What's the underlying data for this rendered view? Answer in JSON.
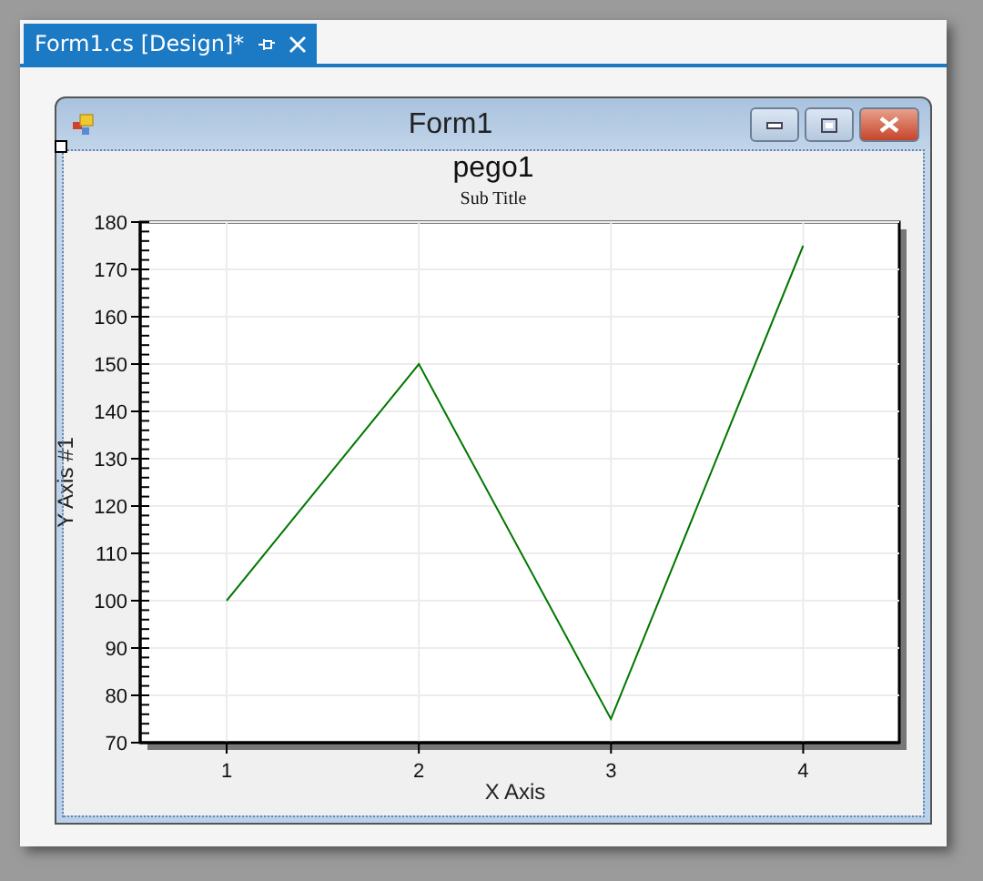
{
  "document_tab": {
    "title": "Form1.cs [Design]*",
    "selected": true
  },
  "form": {
    "title": "Form1"
  },
  "chart_title": "pego1",
  "chart_subtitle": "Sub Title",
  "chart_data": {
    "type": "line",
    "xlabel": "X Axis",
    "ylabel": "Y Axis #1",
    "x": [
      1,
      2,
      3,
      4
    ],
    "series": [
      {
        "color": "#007800",
        "values": [
          100,
          150,
          75,
          175
        ]
      }
    ],
    "grid": true,
    "xlim": [
      0.55,
      4.5
    ],
    "ylim": [
      70,
      180
    ],
    "xticks": [
      1,
      2,
      3,
      4
    ],
    "yticks": [
      70,
      80,
      90,
      100,
      110,
      120,
      130,
      140,
      150,
      160,
      170,
      180
    ]
  }
}
